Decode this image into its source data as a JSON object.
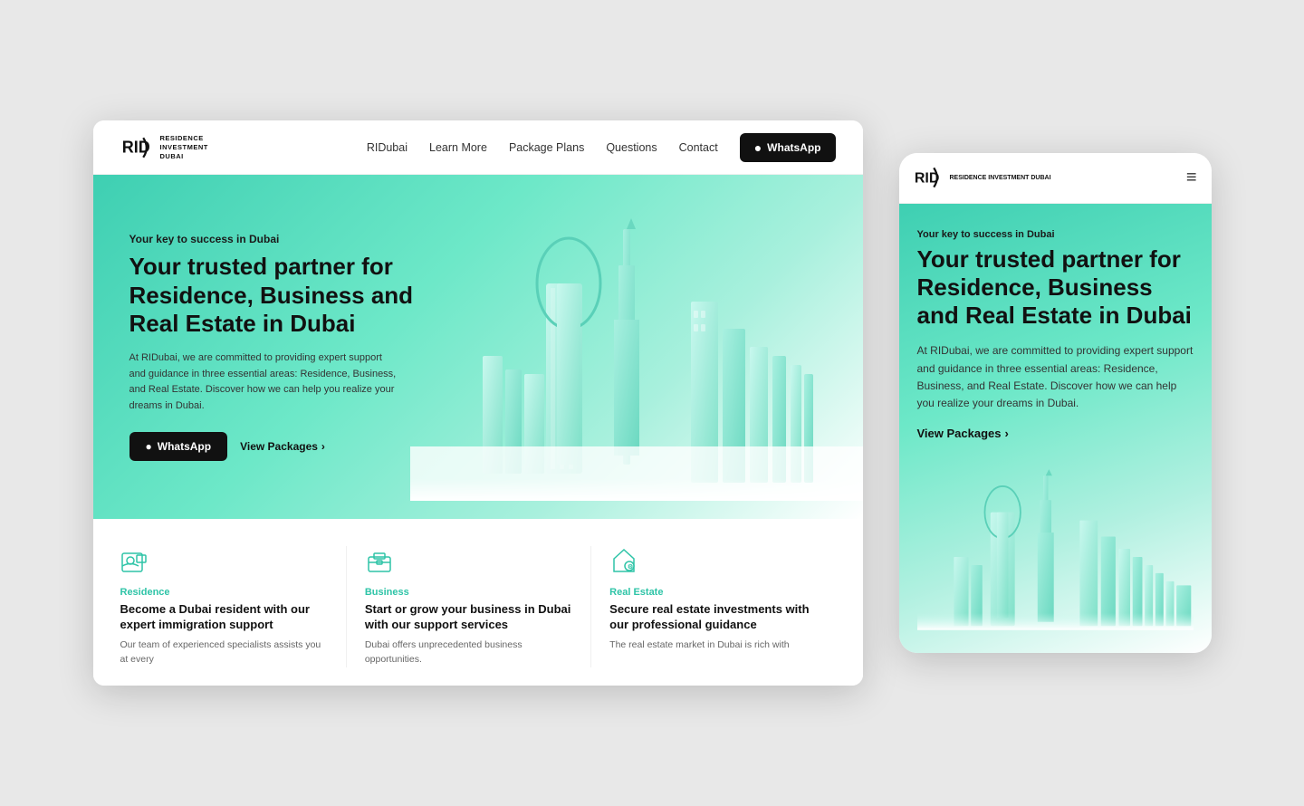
{
  "brand": {
    "logo_text": "RID",
    "name_line1": "RESIDENCE",
    "name_line2": "INVESTMENT",
    "name_line3": "DUBAI"
  },
  "desktop": {
    "nav": {
      "links": [
        {
          "label": "RIDubai",
          "href": "#"
        },
        {
          "label": "Learn More",
          "href": "#"
        },
        {
          "label": "Package Plans",
          "href": "#"
        },
        {
          "label": "Questions",
          "href": "#"
        },
        {
          "label": "Contact",
          "href": "#"
        }
      ],
      "whatsapp_btn": "WhatsApp"
    },
    "hero": {
      "subtitle": "Your key to success in Dubai",
      "title": "Your trusted partner for Residence, Business and Real Estate in Dubai",
      "description": "At RIDubai, we are committed to providing expert support and guidance in three essential areas: Residence, Business, and Real Estate. Discover how we can help you realize your dreams in Dubai.",
      "whatsapp_btn": "WhatsApp",
      "packages_link": "View Packages"
    },
    "features": [
      {
        "category": "Residence",
        "title": "Become a Dubai resident with our expert immigration support",
        "description": "Our team of experienced specialists assists you at every"
      },
      {
        "category": "Business",
        "title": "Start or grow your business in Dubai with our support services",
        "description": "Dubai offers unprecedented business opportunities."
      },
      {
        "category": "Real Estate",
        "title": "Secure real estate investments with our professional guidance",
        "description": "The real estate market in Dubai is rich with"
      }
    ]
  },
  "mobile": {
    "hero": {
      "subtitle": "Your key to success in Dubai",
      "title": "Your trusted partner for Residence, Business and Real Estate in Dubai",
      "description": "At RIDubai, we are committed to providing expert support and guidance in three essential areas: Residence, Business, and Real Estate. Discover how we can help you realize your dreams in Dubai.",
      "packages_link": "View Packages"
    },
    "hamburger_label": "≡"
  }
}
